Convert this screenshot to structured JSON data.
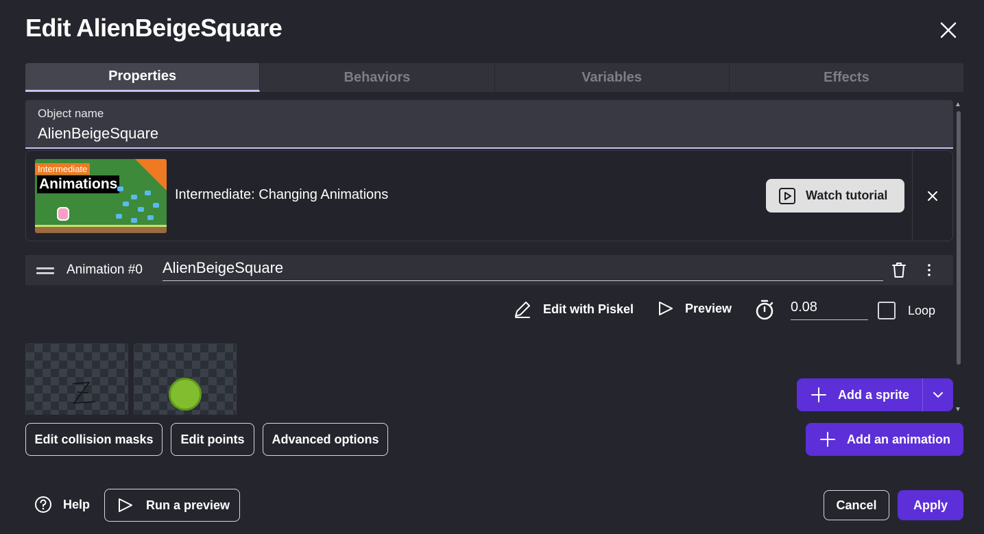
{
  "dialog": {
    "title": "Edit AlienBeigeSquare"
  },
  "tabs": [
    {
      "label": "Properties",
      "active": true
    },
    {
      "label": "Behaviors",
      "active": false
    },
    {
      "label": "Variables",
      "active": false
    },
    {
      "label": "Effects",
      "active": false
    }
  ],
  "object_name": {
    "label": "Object name",
    "value": "AlienBeigeSquare"
  },
  "tutorial": {
    "thumb_badge": "Intermediate",
    "thumb_title": "Animations",
    "title": "Intermediate: Changing Animations",
    "watch_label": "Watch tutorial"
  },
  "animation": {
    "label": "Animation #0",
    "name": "AlienBeigeSquare",
    "edit_piskel_label": "Edit with Piskel",
    "preview_label": "Preview",
    "timing_value": "0.08",
    "loop_label": "Loop",
    "loop_checked": false
  },
  "sprites": [
    {
      "name": "sprite-frame-1"
    },
    {
      "name": "sprite-frame-2"
    }
  ],
  "buttons": {
    "add_sprite": "Add a sprite",
    "edit_collision": "Edit collision masks",
    "edit_points": "Edit points",
    "advanced": "Advanced options",
    "add_animation": "Add an animation"
  },
  "footer": {
    "help": "Help",
    "run_preview": "Run a preview",
    "cancel": "Cancel",
    "apply": "Apply"
  },
  "colors": {
    "background": "#25252e",
    "accent": "#5c2fd8",
    "tab_underline": "#c5c2f2"
  }
}
